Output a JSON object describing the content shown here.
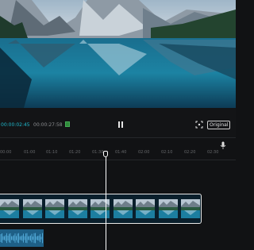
{
  "player": {
    "current_time": "00:00:02:45",
    "total_time": "00:00:27:58",
    "aspect_label": "Original",
    "play_state": "paused"
  },
  "icons": {
    "pause": "pause-icon",
    "fullscreen": "fullscreen-icon",
    "mic": "microphone-icon",
    "meter": "audio-meter-icon"
  },
  "timeline": {
    "ruler_ticks": [
      "00:00",
      "00:10",
      "00:20",
      "01:00",
      "01:10",
      "01:20",
      "01:30",
      "02:00",
      "02:10",
      "02:20"
    ],
    "ruler_ticks_display": [
      "00:00",
      "01:00",
      "01:10",
      "01:20",
      "01:30",
      "01:40",
      "02:00",
      "02:10",
      "02:20",
      "02:30"
    ]
  },
  "colors": {
    "accent": "#1fb8cc",
    "background": "#111214",
    "audio": "#1e5f86"
  }
}
